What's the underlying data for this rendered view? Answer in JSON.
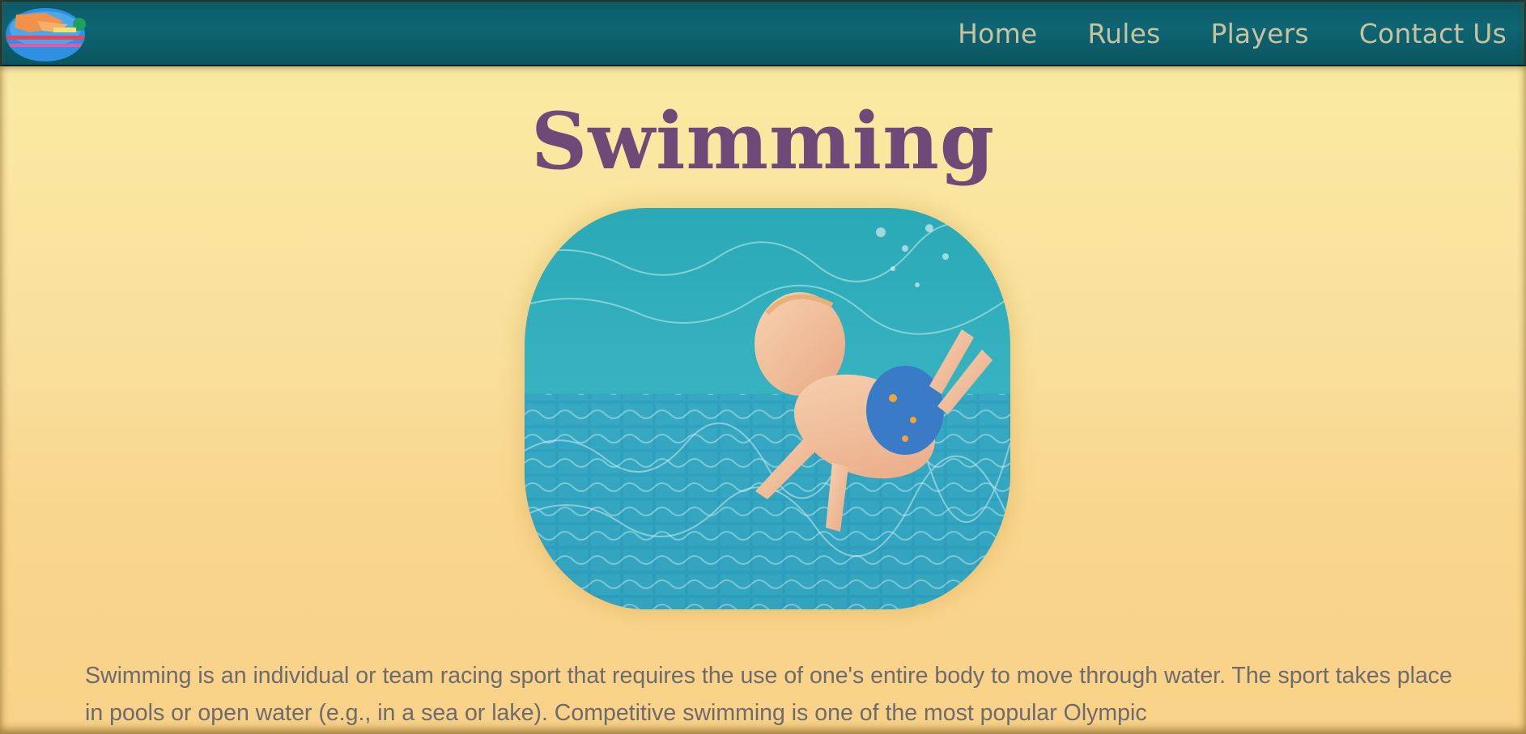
{
  "header": {
    "logo_icon": "swimmer-logo-icon",
    "nav": {
      "home": "Home",
      "rules": "Rules",
      "players": "Players",
      "contact": "Contact Us"
    }
  },
  "main": {
    "title": "Swimming",
    "hero_image": "baby-swimming-underwater-image",
    "intro": "Swimming is an individual or team racing sport that requires the use of one's entire body to move through water. The sport takes place in pools or open water (e.g., in a sea or lake). Competitive swimming is one of the most popular Olympic"
  },
  "colors": {
    "header_bg": "#0e6573",
    "nav_text": "#c9c29f",
    "title": "#6f4a78",
    "page_bg": "#f9e09c",
    "body_text": "#6e6a6e"
  }
}
